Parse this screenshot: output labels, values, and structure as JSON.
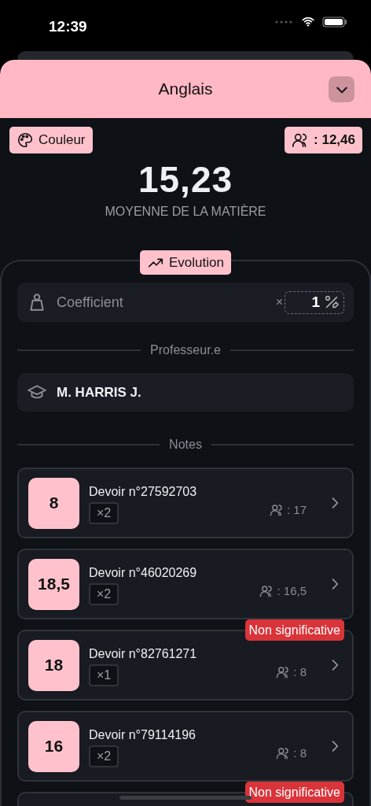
{
  "status_bar": {
    "time": "12:39"
  },
  "sheet": {
    "title": "Anglais",
    "color": "#ffb8c4"
  },
  "color_button": {
    "label": "Couleur"
  },
  "class_average": {
    "value": ": 12,46"
  },
  "average": {
    "value": "15,23",
    "label": "MOYENNE DE LA MATIÈRE"
  },
  "evolution_button": {
    "label": "Evolution"
  },
  "coefficient": {
    "label": "Coefficient",
    "prefix": "×",
    "value": "1"
  },
  "teacher_section": {
    "title": "Professeur.e",
    "name": "M. HARRIS J."
  },
  "notes_section": {
    "title": "Notes"
  },
  "notes": [
    {
      "grade": "8",
      "title": "Devoir n°27592703",
      "coefficient": "×2",
      "class_average": ": 17"
    },
    {
      "grade": "18,5",
      "title": "Devoir n°46020269",
      "coefficient": "×2",
      "class_average": ": 16,5"
    },
    {
      "grade": "18",
      "title": "Devoir n°82761271",
      "coefficient": "×1",
      "class_average": ": 8",
      "badge": "Non significative"
    },
    {
      "grade": "16",
      "title": "Devoir n°79114196",
      "coefficient": "×2",
      "class_average": ": 8"
    },
    {
      "badge": "Non significative"
    }
  ]
}
